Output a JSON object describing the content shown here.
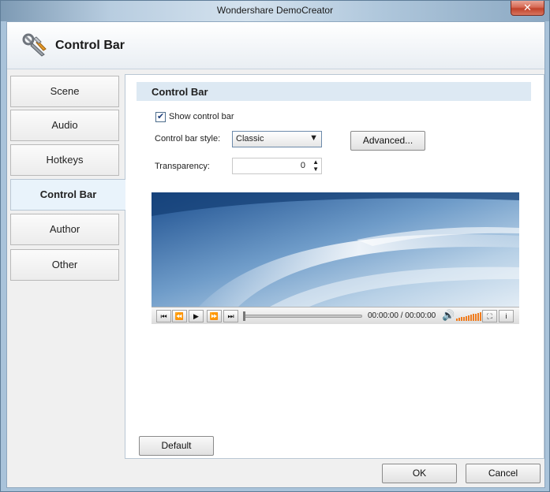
{
  "window": {
    "title": "Wondershare DemoCreator",
    "close_glyph": "✕"
  },
  "header": {
    "title": "Control Bar",
    "icon": "tools-icon"
  },
  "nav": {
    "items": [
      {
        "label": "Scene"
      },
      {
        "label": "Audio"
      },
      {
        "label": "Hotkeys"
      },
      {
        "label": "Control Bar",
        "active": true
      },
      {
        "label": "Author"
      },
      {
        "label": "Other"
      }
    ]
  },
  "section": {
    "title": "Control Bar",
    "show_control_bar_label": "Show control bar",
    "show_control_bar_checked": true,
    "style_label": "Control bar style:",
    "style_value": "Classic",
    "advanced_label": "Advanced...",
    "transparency_label": "Transparency:",
    "transparency_value": "0"
  },
  "player": {
    "time": "00:00:00 / 00:00:00",
    "info_glyph": "i",
    "volume_level": 1.0,
    "accent_color": "#f07c1e"
  },
  "footer": {
    "default_label": "Default",
    "ok_label": "OK",
    "cancel_label": "Cancel"
  }
}
